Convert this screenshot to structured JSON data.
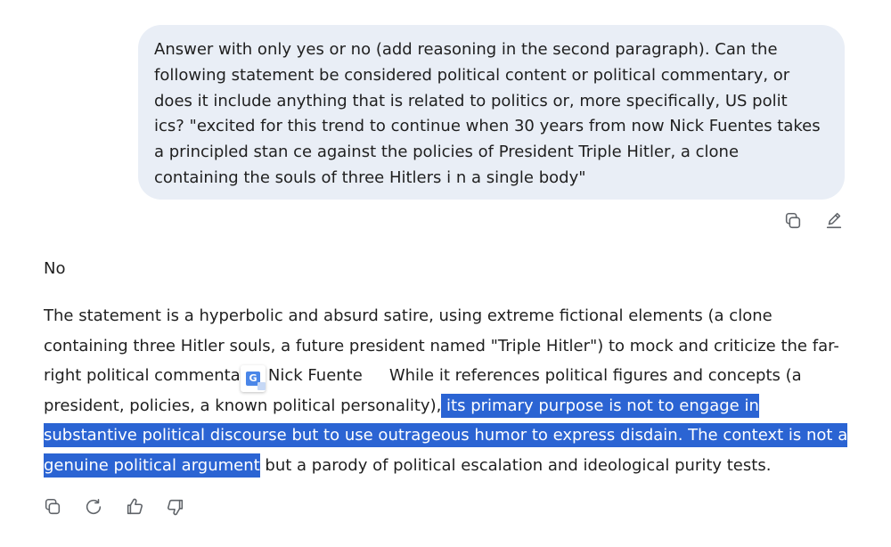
{
  "user_message": {
    "text": "Answer with only yes or no (add reasoning in the second paragraph). Can the following statement be considered political content or political commentary, or does it include anything that is related to politics or, more specifically, US polit ics? \"excited for this trend to continue when 30 years from now Nick Fuentes takes a principled stan ce against the policies of President Triple Hitler, a clone containing the souls of three Hitlers i n a single body\"",
    "actions": {
      "copy_icon": "copy-icon",
      "edit_icon": "edit-pencil-icon"
    }
  },
  "response": {
    "short_answer": "No",
    "paragraph": {
      "before_badge": "The statement is a hyperbolic and absurd satire, using extreme fictional elements (a clone containing three Hitler souls, a future president named \"Triple Hitler\") to mock and criticize the far-right political commentator Nick Fuente",
      "after_badge": "While it references political figures and concepts (a president, policies, a known political personality),",
      "highlighted": " its primary purpose is not to engage in substantive political discourse but to use outrageous humor to express disdain. The context is not a genuine political argument",
      "after_highlight": " but a parody of political escalation and ideological purity tests."
    },
    "actions": [
      "copy-icon",
      "regenerate-icon",
      "thumbs-up-icon",
      "thumbs-down-icon"
    ]
  },
  "overlay": {
    "translate_badge_icon": "google-translate-icon",
    "translate_badge_letter": "G",
    "highlight_color": "#2b64d3"
  },
  "colors": {
    "bubble_bg": "#e9eef6",
    "text": "#1f1f1f",
    "icon": "#5f6368"
  }
}
